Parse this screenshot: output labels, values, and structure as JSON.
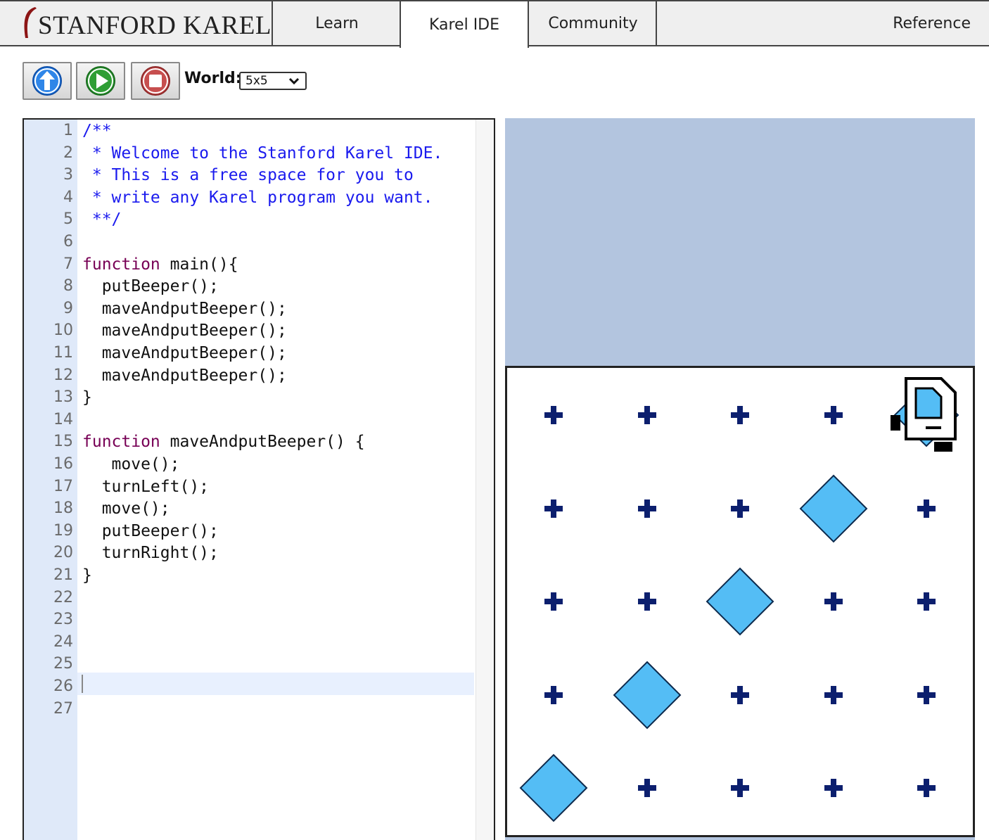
{
  "nav": {
    "logo": "STANFORD KAREL",
    "tabs": [
      {
        "label": "Learn"
      },
      {
        "label": "Karel IDE",
        "active": true
      },
      {
        "label": "Community"
      },
      {
        "label": "Reference"
      }
    ]
  },
  "toolbar": {
    "buttons": [
      {
        "name": "upload-button",
        "icon": "up-arrow-icon"
      },
      {
        "name": "run-button",
        "icon": "play-icon"
      },
      {
        "name": "stop-button",
        "icon": "stop-icon"
      }
    ],
    "world_label": "World:",
    "world_value": "5x5"
  },
  "editor": {
    "active_line": 26,
    "lines": [
      {
        "num": "1",
        "text": "/**",
        "type": "comment"
      },
      {
        "num": "2",
        "text": " * Welcome to the Stanford Karel IDE.",
        "type": "comment"
      },
      {
        "num": "3",
        "text": " * This is a free space for you to",
        "type": "comment"
      },
      {
        "num": "4",
        "text": " * write any Karel program you want.",
        "type": "comment"
      },
      {
        "num": "5",
        "text": " **/",
        "type": "comment"
      },
      {
        "num": "6",
        "text": "",
        "type": "code"
      },
      {
        "num": "7",
        "kw": "function",
        "text": " main(){",
        "type": "code"
      },
      {
        "num": "8",
        "text": "  putBeeper();",
        "type": "code"
      },
      {
        "num": "9",
        "text": "  maveAndputBeeper();",
        "type": "code"
      },
      {
        "num": "10",
        "text": "  maveAndputBeeper();",
        "type": "code"
      },
      {
        "num": "11",
        "text": "  maveAndputBeeper();",
        "type": "code"
      },
      {
        "num": "12",
        "text": "  maveAndputBeeper();",
        "type": "code"
      },
      {
        "num": "13",
        "text": "}",
        "type": "code"
      },
      {
        "num": "14",
        "text": "",
        "type": "code"
      },
      {
        "num": "15",
        "kw": "function",
        "text": " maveAndputBeeper() {",
        "type": "code"
      },
      {
        "num": "16",
        "text": "   move();",
        "type": "code"
      },
      {
        "num": "17",
        "text": "  turnLeft();",
        "type": "code"
      },
      {
        "num": "18",
        "text": "  move();",
        "type": "code"
      },
      {
        "num": "19",
        "text": "  putBeeper();",
        "type": "code"
      },
      {
        "num": "20",
        "text": "  turnRight();",
        "type": "code"
      },
      {
        "num": "21",
        "text": "}",
        "type": "code"
      },
      {
        "num": "22",
        "text": "",
        "type": "code"
      },
      {
        "num": "23",
        "text": "",
        "type": "code"
      },
      {
        "num": "24",
        "text": "",
        "type": "code"
      },
      {
        "num": "25",
        "text": "",
        "type": "code"
      },
      {
        "num": "26",
        "text": "",
        "type": "code"
      },
      {
        "num": "27",
        "text": "",
        "type": "code"
      }
    ]
  },
  "world": {
    "size": "5x5",
    "beepers": [
      [
        1,
        1
      ],
      [
        2,
        2
      ],
      [
        3,
        3
      ],
      [
        4,
        4
      ],
      [
        5,
        5
      ]
    ],
    "karel": {
      "street": 5,
      "avenue": 5,
      "facing": "north"
    },
    "colors": {
      "background": "#b3c5df",
      "beeper": "#54bdf5",
      "corner": "#0c1f6e"
    }
  }
}
